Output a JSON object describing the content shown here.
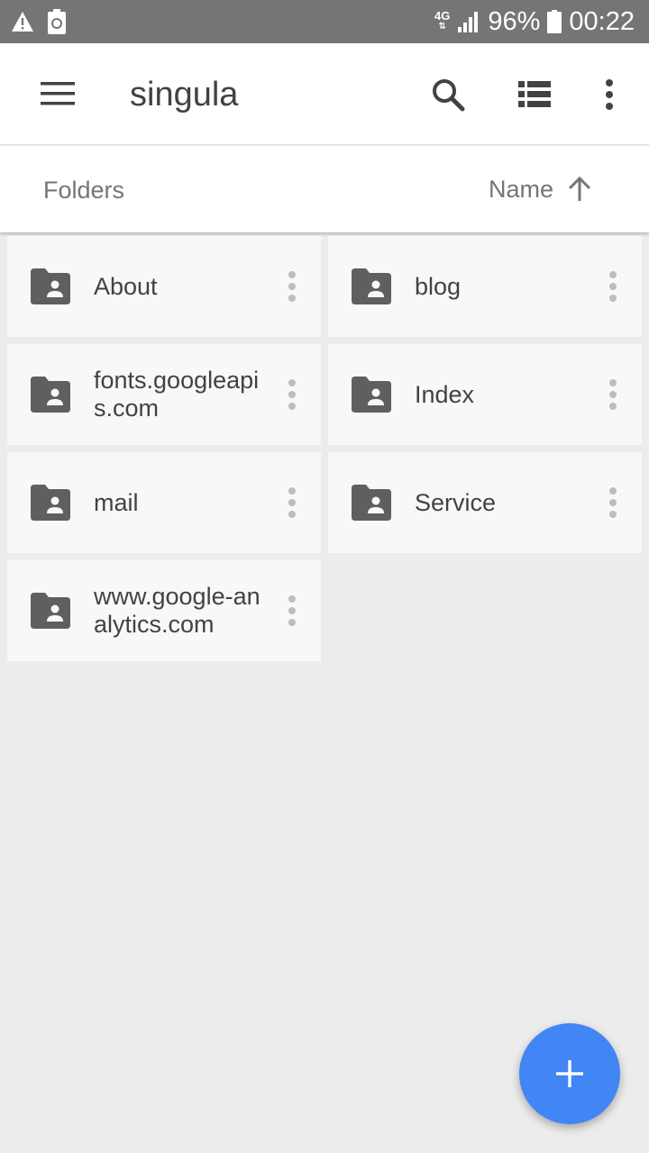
{
  "status_bar": {
    "left_icons": [
      "warning-icon",
      "battery-saver-icon"
    ],
    "network": "4G",
    "battery_percent": "96%",
    "time": "00:22"
  },
  "app_bar": {
    "title": "singula",
    "icons": [
      "menu-icon",
      "search-icon",
      "list-view-icon",
      "more-vert-icon"
    ]
  },
  "sort_bar": {
    "section_label": "Folders",
    "sort_label": "Name",
    "sort_direction_icon": "arrow-up-icon"
  },
  "folders": [
    {
      "name": "About"
    },
    {
      "name": "blog"
    },
    {
      "name": "fonts.googleapis.com"
    },
    {
      "name": "Index"
    },
    {
      "name": "mail"
    },
    {
      "name": "Service"
    },
    {
      "name": "www.google-analytics.com"
    }
  ],
  "fab": {
    "icon": "plus-icon"
  },
  "colors": {
    "status_bar": "#757575",
    "accent": "#4285f4",
    "folder_icon": "#5f5f5f",
    "background": "#ececec"
  }
}
